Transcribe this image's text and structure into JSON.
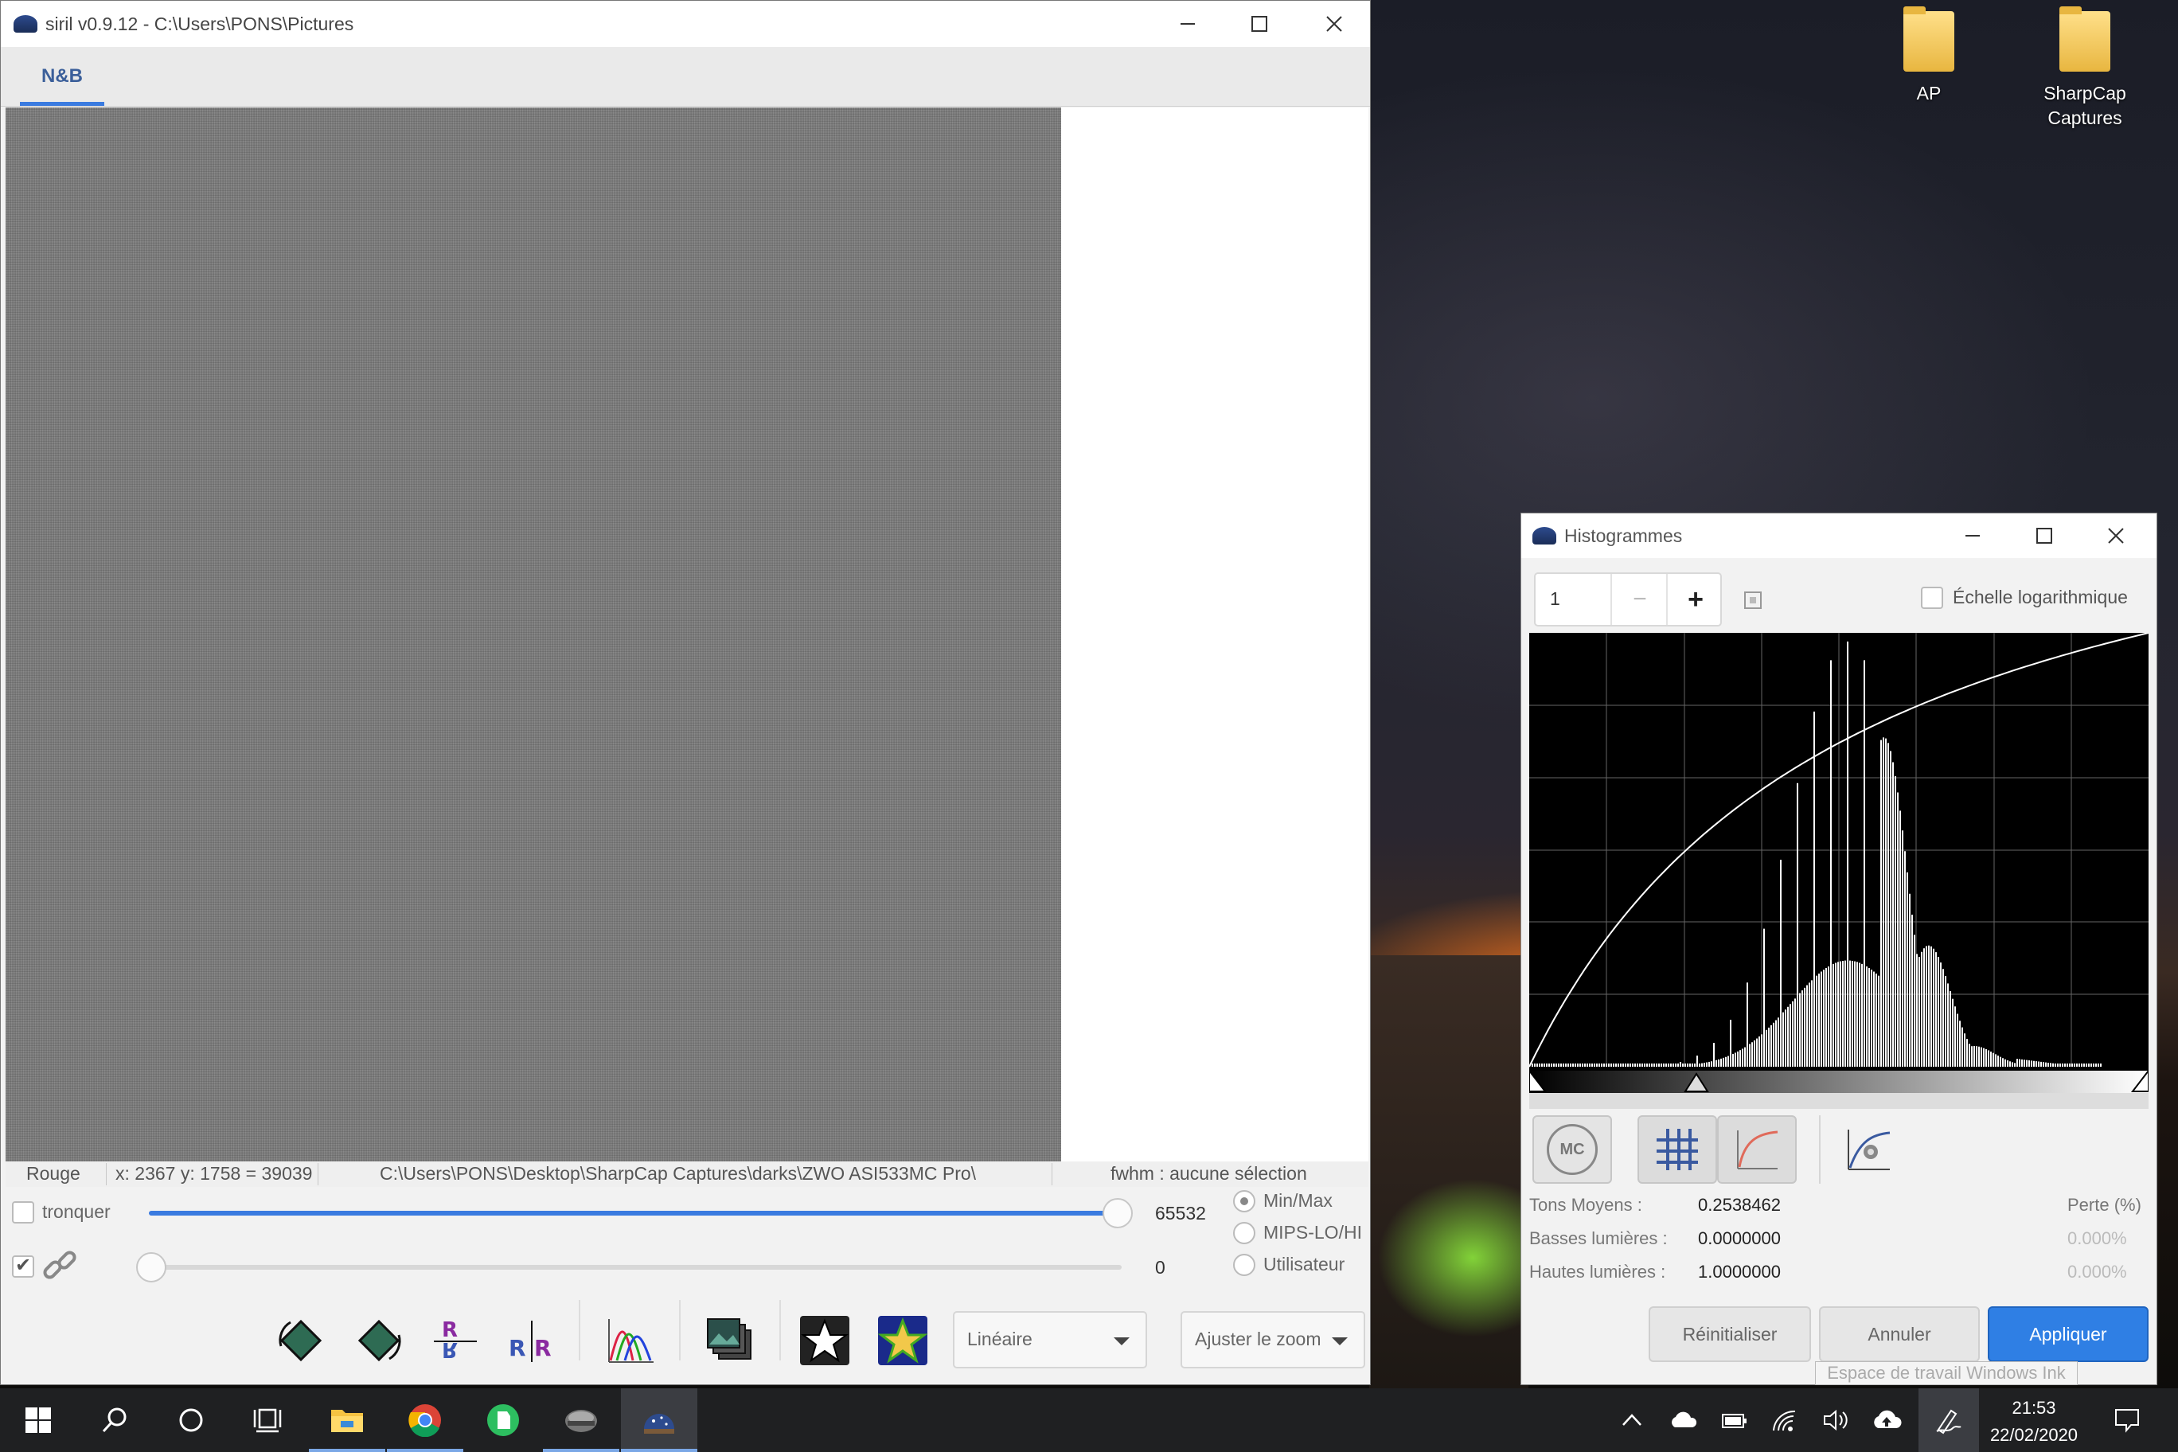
{
  "desktop": {
    "icons": [
      {
        "label_line1": "AP",
        "label_line2": ""
      },
      {
        "label_line1": "SharpCap",
        "label_line2": "Captures"
      }
    ]
  },
  "main_window": {
    "title": "siril v0.9.12 - C:\\Users\\PONS\\Pictures",
    "tab": "N&B",
    "status": {
      "channel": "Rouge",
      "coords": "x: 2367 y: 1758 = 39039",
      "path": "C:\\Users\\PONS\\Desktop\\SharpCap Captures\\darks\\ZWO ASI533MC Pro\\",
      "fwhm": "fwhm : aucune sélection"
    },
    "controls": {
      "tronquer_label": "tronquer",
      "tronquer_checked": false,
      "link_checked": true,
      "high_value": "65532",
      "low_value": "0",
      "radio_options": [
        "Min/Max",
        "MIPS-LO/HI",
        "Utilisateur"
      ],
      "radio_selected": "Min/Max",
      "display_mode": "Linéaire",
      "zoom_mode": "Ajuster le zoom"
    },
    "toolbar_icons": [
      "rotate-left-icon",
      "rotate-right-icon",
      "mirror-x-icon",
      "mirror-y-icon",
      "histogram-curve-icon",
      "image-stack-icon",
      "star-icon",
      "color-star-icon"
    ]
  },
  "histogram_window": {
    "title": "Histogrammes",
    "spin_value": "1",
    "log_scale_label": "Échelle logarithmique",
    "log_scale_checked": false,
    "stats": {
      "midtones_label": "Tons Moyens :",
      "midtones_value": "0.2538462",
      "shadows_label": "Basses lumières :",
      "shadows_value": "0.0000000",
      "highlights_label": "Hautes lumières :",
      "highlights_value": "1.0000000",
      "loss_header": "Perte (%)",
      "shadows_loss": "0.000%",
      "highlights_loss": "0.000%"
    },
    "mc_label": "MC",
    "buttons": {
      "reset": "Réinitialiser",
      "cancel": "Annuler",
      "apply": "Appliquer"
    },
    "tooltip": "Espace de travail Windows Ink",
    "colors": {
      "apply": "#2f7fe4",
      "histogram_bg": "#000000"
    }
  },
  "taskbar": {
    "apps": [
      "windows-start-icon",
      "search-icon",
      "cortana-icon",
      "task-view-icon",
      "file-explorer-icon",
      "chrome-icon",
      "evernote-icon",
      "app-icon",
      "siril-icon"
    ],
    "time": "21:53",
    "date": "22/02/2020"
  }
}
